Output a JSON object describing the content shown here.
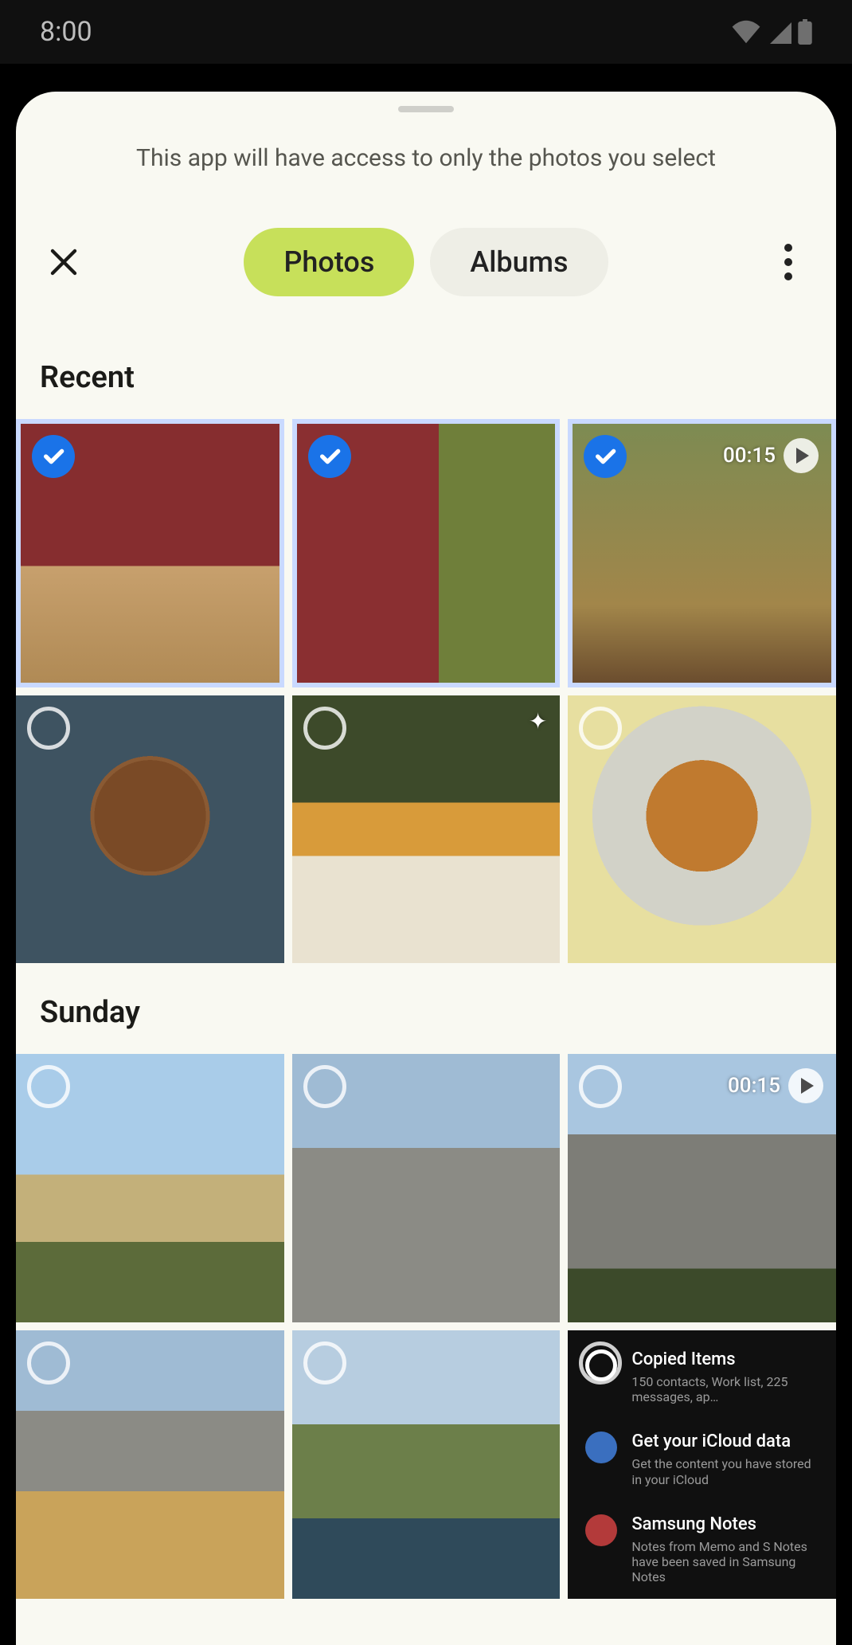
{
  "status": {
    "time": "8:00"
  },
  "sheet": {
    "permission_text": "This app will have access to only the photos you select",
    "tabs": {
      "photos": "Photos",
      "albums": "Albums",
      "active": "photos"
    }
  },
  "sections": [
    {
      "title": "Recent",
      "items": [
        {
          "selected": true,
          "is_video": false
        },
        {
          "selected": true,
          "is_video": false
        },
        {
          "selected": true,
          "is_video": true,
          "duration": "00:15"
        },
        {
          "selected": false,
          "is_video": false
        },
        {
          "selected": false,
          "is_video": false,
          "sparkle": true
        },
        {
          "selected": false,
          "is_video": false
        }
      ]
    },
    {
      "title": "Sunday",
      "items": [
        {
          "selected": false,
          "is_video": false
        },
        {
          "selected": false,
          "is_video": false
        },
        {
          "selected": false,
          "is_video": true,
          "duration": "00:15"
        },
        {
          "selected": false,
          "is_video": false
        },
        {
          "selected": false,
          "is_video": false
        },
        {
          "selected": false,
          "is_video": false,
          "notification_overlay": true
        }
      ]
    }
  ],
  "notifications": [
    {
      "title": "Copied Items",
      "subtitle": "150 contacts, Work list, 225 messages, ap…"
    },
    {
      "title": "Get your iCloud data",
      "subtitle": "Get the content you have stored in your iCloud"
    },
    {
      "title": "Samsung Notes",
      "subtitle": "Notes from Memo and S Notes have been saved in Samsung Notes"
    }
  ]
}
